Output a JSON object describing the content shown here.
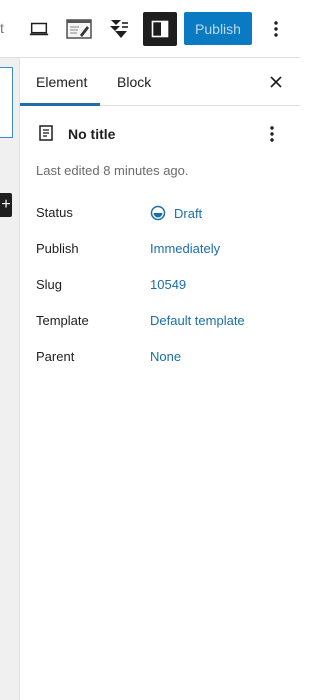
{
  "toolbar": {
    "partial_text": "t",
    "publish_label": "Publish",
    "icons": {
      "desktop": "desktop-icon",
      "preview": "preview-icon",
      "plugin": "plugin-icon",
      "settings": "settings-sidebar-icon",
      "more": "more-vertical-icon"
    }
  },
  "canvas": {
    "add_label": "+"
  },
  "sidebar": {
    "tabs": [
      {
        "label": "Element",
        "active": true
      },
      {
        "label": "Block",
        "active": false
      }
    ],
    "close_icon": "close-icon",
    "document": {
      "title": "No title",
      "last_edited": "Last edited 8 minutes ago.",
      "icon": "document-icon"
    },
    "rows": [
      {
        "label": "Status",
        "value": "Draft"
      },
      {
        "label": "Publish",
        "value": "Immediately"
      },
      {
        "label": "Slug",
        "value": "10549"
      },
      {
        "label": "Template",
        "value": "Default template"
      },
      {
        "label": "Parent",
        "value": "None"
      }
    ]
  },
  "colors": {
    "accent": "#1a6ea8",
    "publish_bg": "#0a7bc2",
    "settings_bg": "#1e1e1e"
  }
}
